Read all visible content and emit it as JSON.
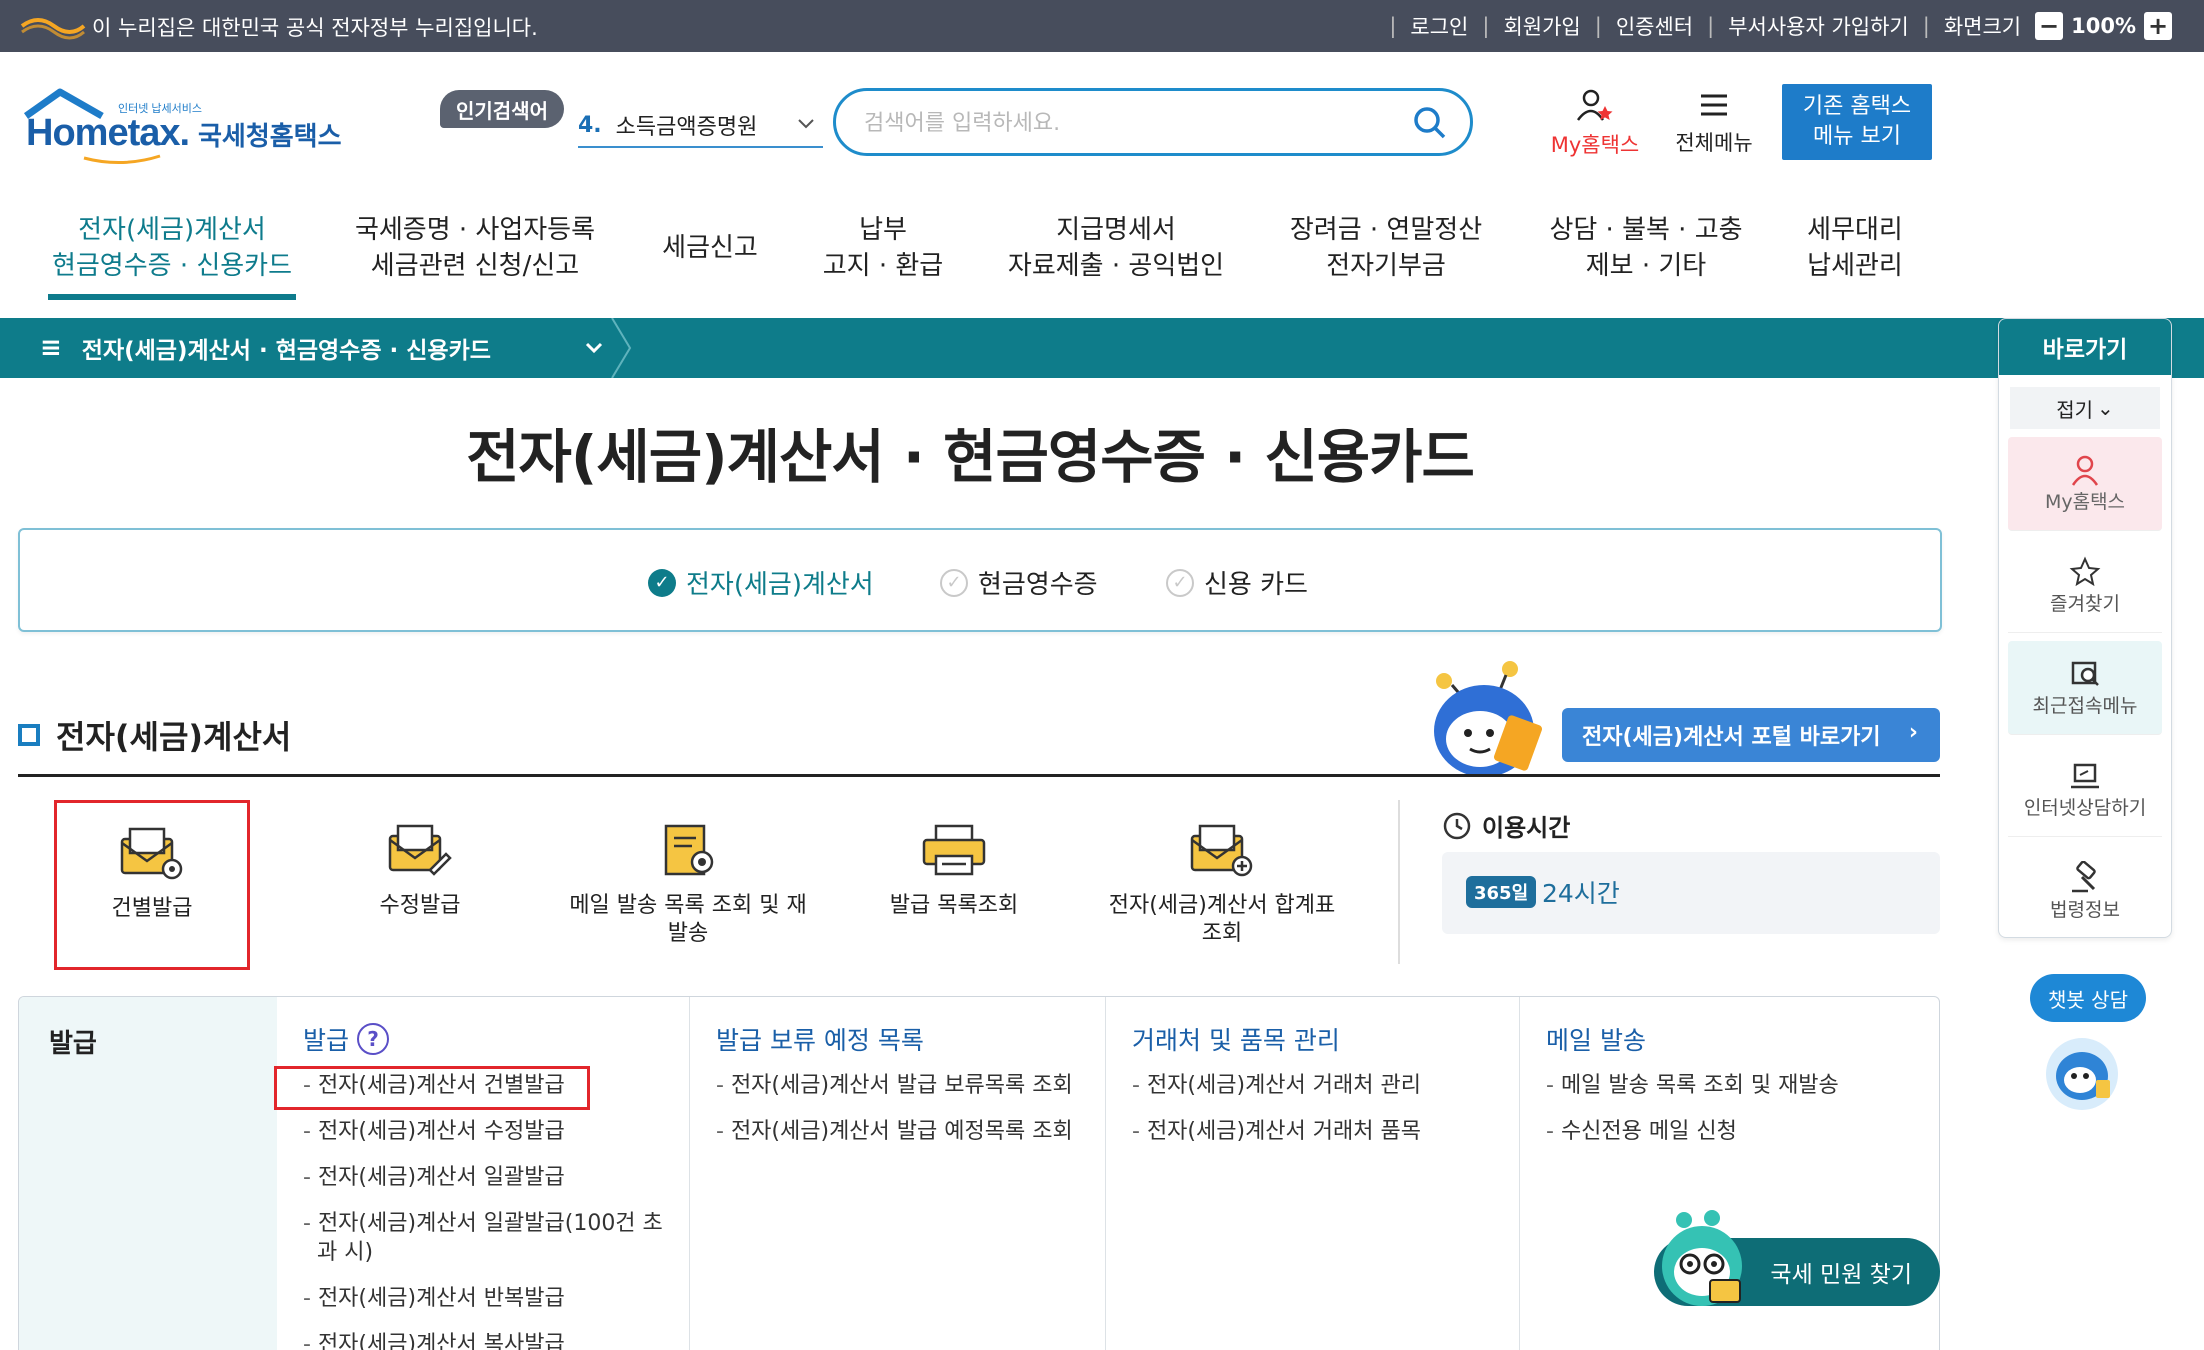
{
  "gov_bar": {
    "notice": "이 누리집은 대한민국 공식 전자정부 누리집입니다.",
    "links": [
      "로그인",
      "회원가입",
      "인증센터",
      "부서사용자 가입하기",
      "화면크기"
    ],
    "zoom": "100%",
    "zoom_minus": "−",
    "zoom_plus": "+"
  },
  "header": {
    "logo_small": "인터넷 납세서비스",
    "logo_main": "Hometax.",
    "logo_kr": "국세청홈택스",
    "popular_badge": "인기검색어",
    "popular_num": "4.",
    "popular_term": "소득금액증명원",
    "search_placeholder": "검색어를 입력하세요.",
    "my_hometax": "My홈택스",
    "all_menu": "전체메뉴",
    "old_menu_line1": "기존 홈택스",
    "old_menu_line2": "메뉴 보기"
  },
  "gnb": [
    {
      "l1": "전자(세금)계산서",
      "l2": "현금영수증 · 신용카드"
    },
    {
      "l1": "국세증명 · 사업자등록",
      "l2": "세금관련 신청/신고"
    },
    {
      "l1": "세금신고",
      "l2": ""
    },
    {
      "l1": "납부",
      "l2": "고지 · 환급"
    },
    {
      "l1": "지급명세서",
      "l2": "자료제출 · 공익법인"
    },
    {
      "l1": "장려금 · 연말정산",
      "l2": "전자기부금"
    },
    {
      "l1": "상담 · 불복 · 고충",
      "l2": "제보 · 기타"
    },
    {
      "l1": "세무대리",
      "l2": "납세관리"
    }
  ],
  "breadcrumb": "전자(세금)계산서 · 현금영수증 · 신용카드",
  "page_title": "전자(세금)계산서 · 현금영수증 · 신용카드",
  "tabs": [
    "전자(세금)계산서",
    "현금영수증",
    "신용 카드"
  ],
  "section": {
    "title": "전자(세금)계산서",
    "portal_button": "전자(세금)계산서 포털 바로가기"
  },
  "quick_icons": [
    {
      "label": "건별발급",
      "icon": "envelope-gear-icon"
    },
    {
      "label": "수정발급",
      "icon": "envelope-edit-icon"
    },
    {
      "label": "메일 발송 목록 조회 및 재발송",
      "icon": "document-search-icon"
    },
    {
      "label": "발급 목록조회",
      "icon": "printer-icon"
    },
    {
      "label": "전자(세금)계산서 합계표 조회",
      "icon": "envelope-plus-icon"
    }
  ],
  "usage": {
    "title": "이용시간",
    "badge": "365일",
    "hours": "24시간"
  },
  "menu_table": {
    "side_label": "발급",
    "columns": [
      {
        "header": "발급",
        "help": "?",
        "items": [
          "전자(세금)계산서 건별발급",
          "전자(세금)계산서 수정발급",
          "전자(세금)계산서 일괄발급",
          "전자(세금)계산서 일괄발급(100건 초과 시)",
          "전자(세금)계산서 반복발급",
          "전자(세금)계산서 복사발급"
        ]
      },
      {
        "header": "발급 보류 예정 목록",
        "items": [
          "전자(세금)계산서 발급 보류목록 조회",
          "전자(세금)계산서 발급 예정목록 조회"
        ]
      },
      {
        "header": "거래처 및 품목 관리",
        "items": [
          "전자(세금)계산서 거래처 관리",
          "전자(세금)계산서 거래처 품목"
        ]
      },
      {
        "header": "메일 발송",
        "items": [
          "메일 발송 목록 조회 및 재발송",
          "수신전용 메일 신청"
        ]
      }
    ]
  },
  "quick_panel": {
    "title": "바로가기",
    "fold": "접기",
    "items": [
      {
        "label": "My홈택스",
        "icon": "person-icon"
      },
      {
        "label": "즐겨찾기",
        "icon": "star-icon"
      },
      {
        "label": "최근접속메뉴",
        "icon": "recent-menu-icon"
      },
      {
        "label": "인터넷상담하기",
        "icon": "laptop-chat-icon"
      },
      {
        "label": "법령정보",
        "icon": "gavel-icon"
      }
    ]
  },
  "chatbot": "챗봇 상담",
  "civil_button": "국세 민원 찾기",
  "colors": {
    "teal": "#0e7c8a",
    "blue": "#1e7cc9",
    "highlight": "#e2262b"
  }
}
